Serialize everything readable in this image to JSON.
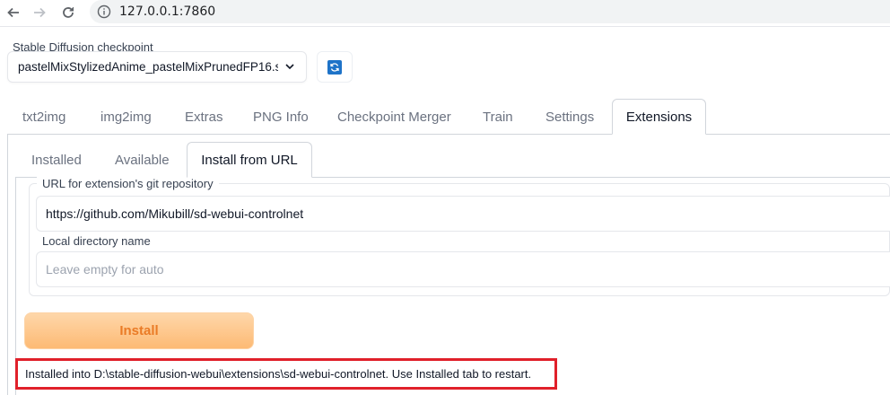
{
  "browser": {
    "url": "127.0.0.1:7860"
  },
  "checkpoint": {
    "label": "Stable Diffusion checkpoint",
    "value": "pastelMixStylizedAnime_pastelMixPrunedFP16.s"
  },
  "main_tabs": [
    {
      "label": "txt2img"
    },
    {
      "label": "img2img"
    },
    {
      "label": "Extras"
    },
    {
      "label": "PNG Info"
    },
    {
      "label": "Checkpoint Merger"
    },
    {
      "label": "Train"
    },
    {
      "label": "Settings"
    },
    {
      "label": "Extensions"
    }
  ],
  "active_main_tab": "Extensions",
  "sub_tabs": [
    {
      "label": "Installed"
    },
    {
      "label": "Available"
    },
    {
      "label": "Install from URL"
    }
  ],
  "active_sub_tab": "Install from URL",
  "form": {
    "url_label": "URL for extension's git repository",
    "url_value": "https://github.com/Mikubill/sd-webui-controlnet",
    "dir_label": "Local directory name",
    "dir_placeholder": "Leave empty for auto",
    "install_label": "Install"
  },
  "result": {
    "text": "Installed into D:\\stable-diffusion-webui\\extensions\\sd-webui-controlnet. Use Installed tab to restart."
  },
  "colors": {
    "accent_orange": "#ea7b26",
    "highlight_red": "#e0202a",
    "refresh_blue": "#1e73c8"
  }
}
